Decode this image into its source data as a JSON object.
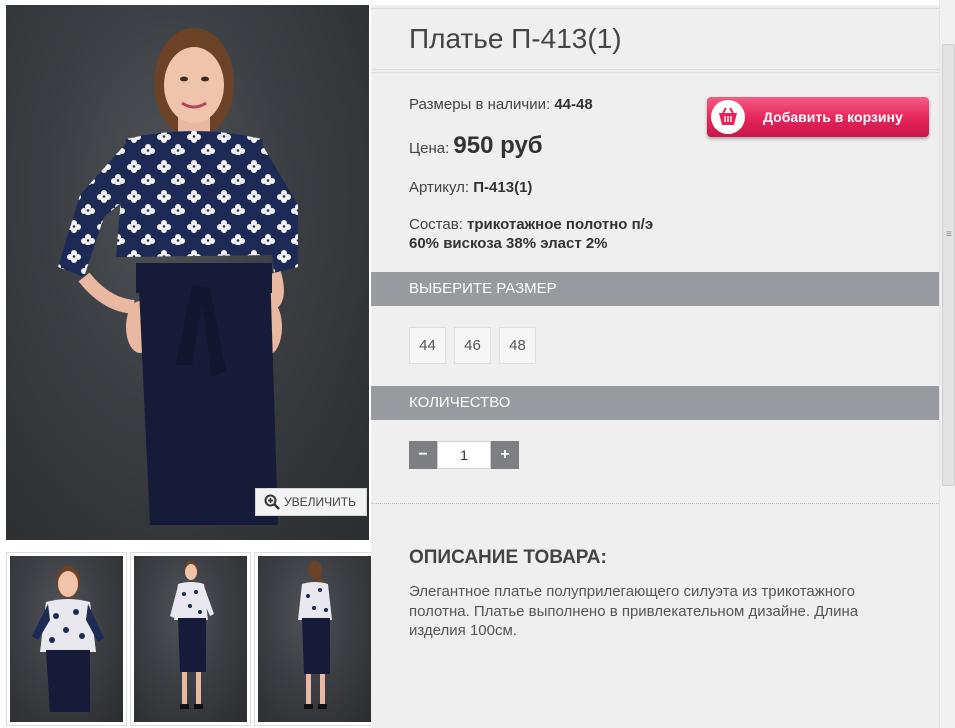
{
  "gallery": {
    "zoom_label": "УВЕЛИЧИТЬ",
    "zoom_icon": "magnify-plus-icon",
    "thumbnails": [
      "thumbnail-front",
      "thumbnail-full",
      "thumbnail-back"
    ]
  },
  "product": {
    "title": "Платье П-413(1)",
    "sizes_label": "Размеры в наличии:",
    "sizes_value": "44-48",
    "price_label": "Цена:",
    "price_value": "950 руб",
    "sku_label": "Артикул:",
    "sku_value": "П-413(1)",
    "composition_label": "Состав:",
    "composition_line1": "трикотажное полотно п/э",
    "composition_line2": "60% вискоза 38% эласт 2%"
  },
  "cart": {
    "add_label": "Добавить в корзину",
    "icon": "basket-icon"
  },
  "size_select": {
    "header": "ВЫБЕРИТЕ РАЗМЕР",
    "options": [
      "44",
      "46",
      "48"
    ]
  },
  "quantity": {
    "header": "КОЛИЧЕСТВО",
    "minus": "−",
    "plus": "+",
    "value": "1"
  },
  "description": {
    "heading": "ОПИСАНИЕ ТОВАРА:",
    "text": "Элегантное платье полуприлегающего силуэта из трикотажного полотна. Платье выполнено в привлекательном дизайне. Длина изделия 100см."
  },
  "colors": {
    "accent": "#e6245a",
    "section_header": "#979a9e",
    "panel_bg": "#efefef",
    "dress_top": "#1c2a55",
    "dress_skirt": "#151b38"
  }
}
